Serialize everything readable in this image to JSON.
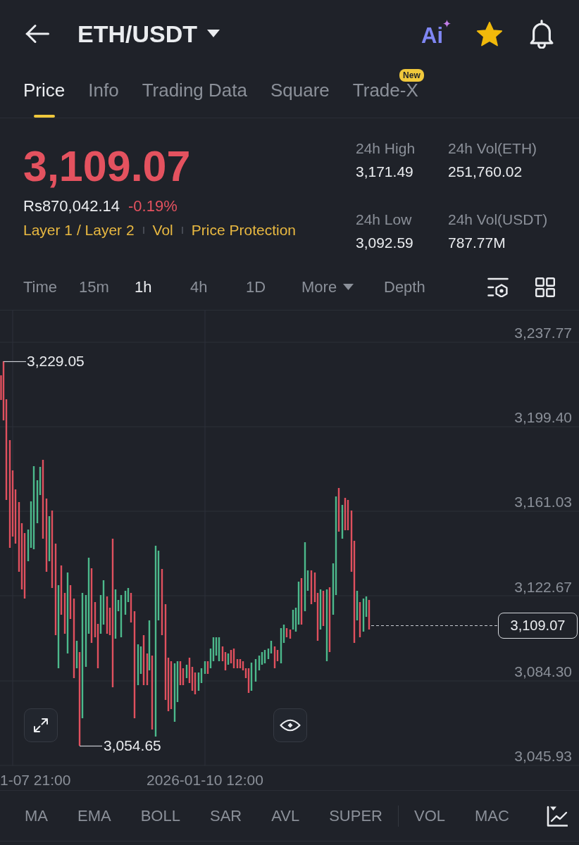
{
  "header": {
    "title": "ETH/USDT",
    "ai_label": "Ai",
    "favorite": true
  },
  "tabs": [
    {
      "label": "Price",
      "selected": true
    },
    {
      "label": "Info",
      "selected": false
    },
    {
      "label": "Trading Data",
      "selected": false
    },
    {
      "label": "Square",
      "selected": false
    },
    {
      "label": "Trade-X",
      "selected": false,
      "badge": "New"
    }
  ],
  "ticker": {
    "last_price": "3,109.07",
    "falling": true,
    "local_price": "Rs870,042.14",
    "change": "-0.19%",
    "tags": [
      "Layer 1 / Layer 2",
      "Vol",
      "Price Protection"
    ]
  },
  "stats": [
    {
      "label": "24h High",
      "value": "3,171.49"
    },
    {
      "label": "24h Vol(ETH)",
      "value": "251,760.02"
    },
    {
      "label": "24h Low",
      "value": "3,092.59"
    },
    {
      "label": "24h Vol(USDT)",
      "value": "787.77M"
    }
  ],
  "intervals": [
    {
      "label": "Time",
      "kind": "option",
      "selected": false
    },
    {
      "label": "15m",
      "kind": "option",
      "selected": false
    },
    {
      "label": "1h",
      "kind": "option",
      "selected": true
    },
    {
      "label": "4h",
      "kind": "option",
      "selected": false
    },
    {
      "label": "1D",
      "kind": "option",
      "selected": false
    },
    {
      "label": "More",
      "kind": "menu",
      "selected": false
    },
    {
      "label": "Depth",
      "kind": "option",
      "selected": false
    }
  ],
  "chart": {
    "y_axis_labels": [
      "3,237.77",
      "3,199.40",
      "3,161.03",
      "3,122.67",
      "3,084.30",
      "3,045.93"
    ],
    "x_axis_labels": [
      "1-07 21:00",
      "2026-01-10 12:00"
    ],
    "high_label": "3,229.05",
    "low_label": "3,054.65",
    "last_price_label": "3,109.07"
  },
  "indicators": {
    "main": [
      "MA",
      "EMA",
      "BOLL",
      "SAR",
      "AVL",
      "SUPER"
    ],
    "sub": [
      "VOL",
      "MAC"
    ]
  }
}
